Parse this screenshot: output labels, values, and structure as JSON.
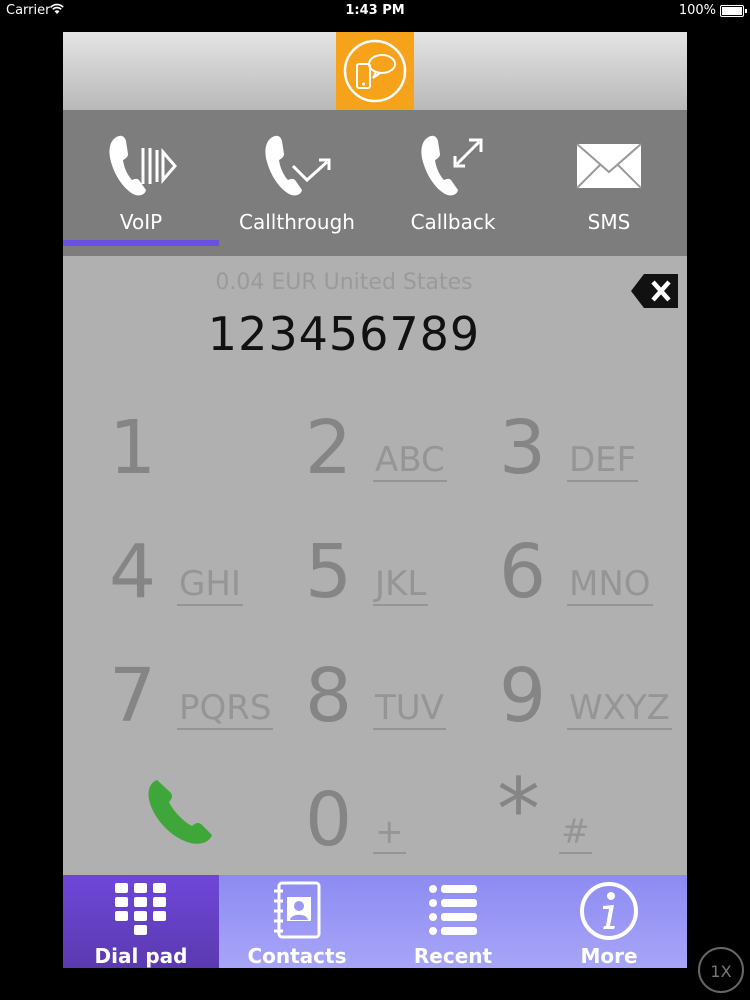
{
  "status_bar": {
    "carrier": "Carrier",
    "time": "1:43 PM",
    "battery": "100%"
  },
  "modes": [
    {
      "label": "VoIP",
      "icon": "voip-phone-icon"
    },
    {
      "label": "Callthrough",
      "icon": "callthrough-phone-icon"
    },
    {
      "label": "Callback",
      "icon": "callback-phone-icon"
    },
    {
      "label": "SMS",
      "icon": "envelope-icon"
    }
  ],
  "selected_mode": "VoIP",
  "dialer": {
    "rate": "0.04 EUR United States",
    "number": "123456789"
  },
  "keypad": [
    {
      "digit": "1",
      "letters": ""
    },
    {
      "digit": "2",
      "letters": "ABC"
    },
    {
      "digit": "3",
      "letters": "DEF"
    },
    {
      "digit": "4",
      "letters": "GHI"
    },
    {
      "digit": "5",
      "letters": "JKL"
    },
    {
      "digit": "6",
      "letters": "MNO"
    },
    {
      "digit": "7",
      "letters": "PQRS"
    },
    {
      "digit": "8",
      "letters": "TUV"
    },
    {
      "digit": "9",
      "letters": "WXYZ"
    },
    {
      "digit": "0",
      "letters": "+"
    },
    {
      "digit": "*",
      "letters": "#"
    }
  ],
  "tabs": [
    {
      "label": "Dial pad",
      "icon": "dialpad-icon"
    },
    {
      "label": "Contacts",
      "icon": "contacts-book-icon"
    },
    {
      "label": "Recent",
      "icon": "list-icon"
    },
    {
      "label": "More",
      "icon": "info-icon"
    }
  ],
  "active_tab": "Dial pad",
  "zoom_label": "1X",
  "colors": {
    "logo": "#f7a21b",
    "mode_indicator": "#6a4fe5",
    "call_button": "#3fa63a",
    "tab_active": "#5b3ab0",
    "tab_bar": "#9a98f4"
  }
}
